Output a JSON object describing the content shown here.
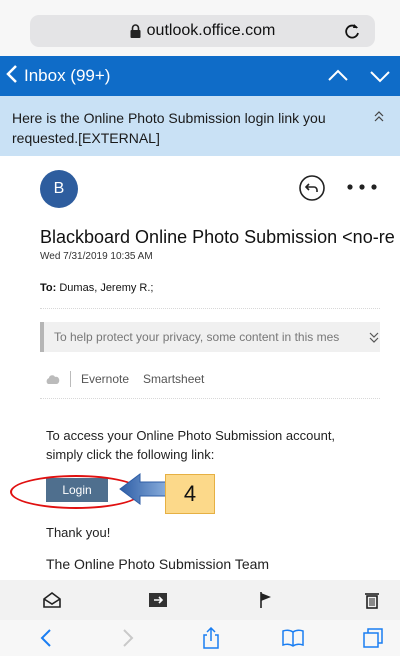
{
  "browser": {
    "url": "outlook.office.com",
    "icons": {
      "lock": "lock-icon",
      "reload": "reload-icon"
    }
  },
  "nav": {
    "back_label": "Inbox (99+)",
    "color": "#0f6cc8"
  },
  "message": {
    "subject": "Here is the Online Photo Submission login link you requested.[EXTERNAL]",
    "avatar_initial": "B",
    "sender": "Blackboard Online Photo Submission <no-re",
    "date": "Wed 7/31/2019 10:35 AM",
    "to_label": "To:",
    "to_value": "Dumas, Jeremy R.;",
    "privacy_notice": "To help protect your privacy, some content in this mes",
    "addins": [
      "Evernote",
      "Smartsheet"
    ],
    "body_line": "To access your Online Photo Submission account, simply click the following link:",
    "login_label": "Login",
    "thanks": "Thank you!",
    "signature": "The Online Photo Submission Team"
  },
  "annotation": {
    "step_number": "4",
    "circle_color": "#e01010",
    "box_color": "#fcd98a"
  },
  "toolbar": {
    "icons": [
      "mark-read-icon",
      "move-icon",
      "flag-icon",
      "delete-icon"
    ]
  },
  "safari_bar": {
    "icons": [
      "back-icon",
      "forward-icon",
      "share-icon",
      "bookmarks-icon",
      "tabs-icon"
    ]
  }
}
